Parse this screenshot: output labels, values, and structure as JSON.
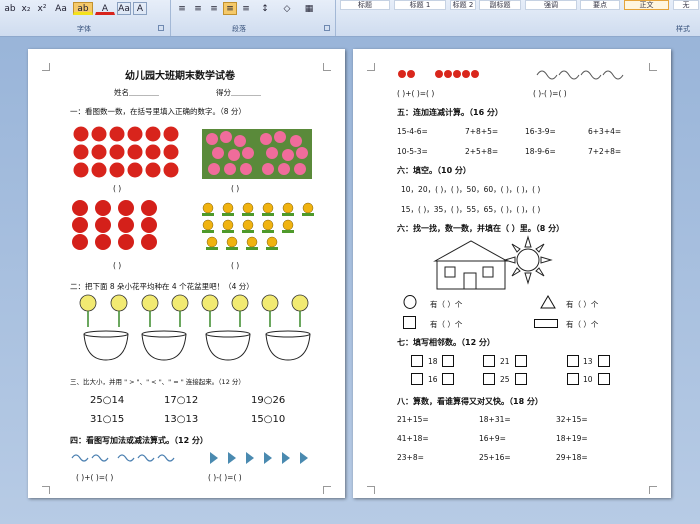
{
  "ribbon": {
    "font_group": "字体",
    "para_group": "段落",
    "styles_group": "样式",
    "styles": [
      "标题",
      "标题 1",
      "标题 2",
      "副标题",
      "强调",
      "要点",
      "正文",
      "无"
    ],
    "font_tools": [
      "ab",
      "x₂",
      "x²",
      "Aa",
      "ab",
      "A",
      "Aa",
      "A"
    ],
    "para_tools": [
      "≡",
      "≡",
      "≡",
      "≡",
      "≡",
      "↕",
      "◇",
      "▦"
    ],
    "colors": {
      "highlight": "#f3e21d",
      "font": "#d8241c",
      "ribbon": "#d6e2f2"
    }
  },
  "page1": {
    "title": "幼儿园大班期末数学试卷",
    "name_label": "姓名＿＿＿＿",
    "score_label": "得分＿＿＿＿",
    "q1": "一：看图数一数，在括号里填入正确的数字。（8 分）",
    "blank": "(  )",
    "q2": "二：把下面 8 朵小花平均种在 4 个花盆里吧！（4 分）",
    "q3": "三、比大小，并用 \" > \"、\" < \"、\" = \" 连接起来。（12 分）",
    "compare": [
      "25○14",
      "17○12",
      "19○26",
      "31○15",
      "13○13",
      "15○10"
    ],
    "q4": "四：看图写加法或减法算式。（12 分）",
    "q4_blank1": "(   )+(   )=(   )",
    "q4_blank2": "(   )-(   )=(   )"
  },
  "page2": {
    "top_blank1": "(   )+(   )=(   )",
    "top_blank2": "(   )-(   )=(   )",
    "q5": "五：连加连减计算。（16 分）",
    "calc5": [
      "15-4-6=",
      "7+8+5=",
      "16-3-9=",
      "6+3+4=",
      "10-5-3=",
      "2+5+8=",
      "18-9-6=",
      "7+2+8="
    ],
    "q6": "六：填空。（10 分）",
    "seq1": "10，20，(   )，(   )，50，60，(   )，(   )，(   )",
    "seq2": "15，(   )，35，(   )，55，65，(   )，(   )，(   )",
    "q6b": "六：找一找，数一数，并填在（  ）里。（8 分）",
    "have": [
      "有（   ）个",
      "有（   ）个",
      "有（   ）个",
      "有（   ）个"
    ],
    "q7": "七：填写相邻数。（12 分）",
    "neighbors": [
      "18",
      "21",
      "13",
      "16",
      "25",
      "10"
    ],
    "q8": "八：算数，看谁算得又对又快。（18 分）",
    "calc8": [
      "21+15=",
      "18+31=",
      "32+15=",
      "41+18=",
      "16+9=",
      "18+19=",
      "23+8=",
      "25+16=",
      "29+18="
    ]
  }
}
